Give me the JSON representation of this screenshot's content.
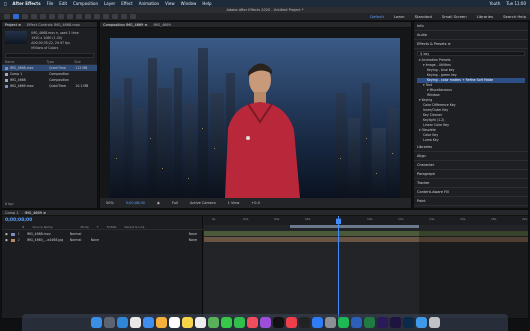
{
  "menubar": {
    "apple_icon": "apple-logo",
    "app_name": "After Effects",
    "items": [
      "File",
      "Edit",
      "Composition",
      "Layer",
      "Effect",
      "Animation",
      "View",
      "Window",
      "Help"
    ],
    "clock": "Tue 11:00",
    "user": "Youth"
  },
  "app": {
    "title": "Adobe After Effects 2020 - Untitled Project *"
  },
  "toolbar": {
    "workspaces": [
      "Default",
      "Learn",
      "Standard",
      "Small Screen",
      "Libraries"
    ],
    "active_workspace": "Default",
    "search_help": "Search Help"
  },
  "project": {
    "tabs": [
      "Project ≡",
      "Effect Controls IMG_4668.mov"
    ],
    "selected_name": "IMG_4668.mov ▾, used 1 time",
    "selected_info": "1920 x 1080 (1.00)",
    "selected_duration": "Δ00;00;35;22, 29.97 fps",
    "selected_sound": "Millions of Colors",
    "columns": [
      "Name",
      "Type",
      "Size"
    ],
    "items": [
      {
        "name": "IMG_4668.mov",
        "type": "QuickTime",
        "size": "112 MB",
        "color": "#7b8dbb",
        "selected": true
      },
      {
        "name": "Comp 1",
        "type": "Composition",
        "size": "",
        "color": "#a5a5c8",
        "selected": false
      },
      {
        "name": "IMG_4668",
        "type": "Composition",
        "size": "",
        "color": "#a5a5c8",
        "selected": false
      },
      {
        "name": "IMG_4669.mov",
        "type": "QuickTime",
        "size": "10.1 MB",
        "color": "#7b8dbb",
        "selected": false
      }
    ],
    "bpc": "8 bpc"
  },
  "viewer": {
    "tabs": [
      "Composition IMG_4669 ≡"
    ],
    "breadcrumb": "IMG_4669",
    "zoom": "50%",
    "timecode": "0;00;08;00",
    "resolution": "Full",
    "camera": "Active Camera",
    "views": "1 View",
    "exposure": "+0.0"
  },
  "right_panel": {
    "sections": [
      "Info",
      "Audio",
      "Effects & Presets ≡"
    ],
    "search_value": "key",
    "tree": [
      {
        "level": 1,
        "text": "▾ Animation Presets",
        "hl": false
      },
      {
        "level": 2,
        "text": "▾ Image - Utilities",
        "hl": false
      },
      {
        "level": 3,
        "text": "Keying - blue key",
        "hl": false
      },
      {
        "level": 3,
        "text": "Keying - green key",
        "hl": false
      },
      {
        "level": 3,
        "text": "Keying - color mattes + Refine Soft Matte",
        "hl": true
      },
      {
        "level": 2,
        "text": "▾ Text",
        "hl": false
      },
      {
        "level": 3,
        "text": "▾ Miscellaneous",
        "hl": false
      },
      {
        "level": 3,
        "text": "Window",
        "hl": false
      },
      {
        "level": 1,
        "text": "▾ Keying",
        "hl": false
      },
      {
        "level": 2,
        "text": "Color Difference Key",
        "hl": false
      },
      {
        "level": 2,
        "text": "Inner/Outer Key",
        "hl": false
      },
      {
        "level": 2,
        "text": "Key Cleaner",
        "hl": false
      },
      {
        "level": 2,
        "text": "Keylight (1.2)",
        "hl": false
      },
      {
        "level": 2,
        "text": "Linear Color Key",
        "hl": false
      },
      {
        "level": 1,
        "text": "▾ Obsolete",
        "hl": false
      },
      {
        "level": 2,
        "text": "Color Key",
        "hl": false
      },
      {
        "level": 2,
        "text": "Luma Key",
        "hl": false
      }
    ],
    "panels_below": [
      "Libraries",
      "Align",
      "Character",
      "Paragraph",
      "Tracker",
      "Content-Aware Fill",
      "Paint"
    ]
  },
  "timeline": {
    "tabs": [
      "Comp 1",
      "IMG_4669 ≡"
    ],
    "timecode": "0;00;08;00",
    "columns": [
      "#",
      "Source Name",
      "Mode",
      "T",
      "TrkMat",
      "Parent & Link"
    ],
    "layers": [
      {
        "num": "1",
        "name": "IMG_4668.mov",
        "mode": "Normal",
        "trkmat": "",
        "parent": "None",
        "label": "#7b8dbb"
      },
      {
        "num": "2",
        "name": "IMG_4660_...a4468.jpg",
        "mode": "Normal",
        "trkmat": "None",
        "parent": "None",
        "label": "#b88a6a"
      }
    ],
    "ruler_ticks": [
      "0s",
      "02s",
      "04s",
      "06s",
      "08s",
      "10s",
      "12s",
      "14s",
      "16s",
      "18s",
      "20s"
    ]
  },
  "dock": {
    "icons": [
      "finder-icon",
      "launchpad-icon",
      "safari-icon",
      "chrome-icon",
      "mail-icon",
      "photos-icon",
      "calendar-icon",
      "notes-icon",
      "reminders-icon",
      "maps-icon",
      "messages-icon",
      "facetime-icon",
      "music-icon",
      "podcasts-icon",
      "tv-icon",
      "news-icon",
      "stocks-icon",
      "app-store-icon",
      "settings-icon",
      "spotify-icon",
      "word-icon",
      "excel-icon",
      "premiere-icon",
      "after-effects-icon",
      "photoshop-icon",
      "folder-icon",
      "trash-icon"
    ],
    "colors": [
      "#3a8ee6",
      "#5b6470",
      "#2f86d6",
      "#e8e8e8",
      "#3f8ef0",
      "#f4b03a",
      "#ffffff",
      "#f7d54a",
      "#eeeeee",
      "#58b05b",
      "#37c74a",
      "#2fbf4a",
      "#f04e5f",
      "#9b4fd8",
      "#111111",
      "#ef3f4a",
      "#222222",
      "#2e7cf6",
      "#8c8f94",
      "#1db954",
      "#2b5fb8",
      "#1f7a44",
      "#2a1a59",
      "#1f1340",
      "#0b2a4a",
      "#3e9ae8",
      "#bfc3c8"
    ]
  }
}
